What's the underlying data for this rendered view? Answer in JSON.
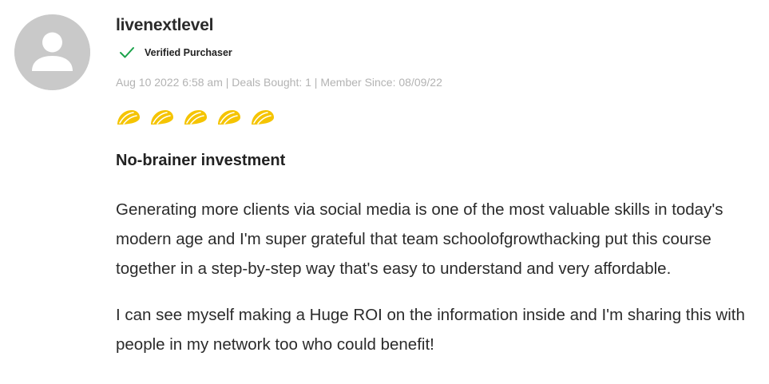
{
  "reviewer": {
    "username": "livenextlevel",
    "verified_label": "Verified Purchaser",
    "avatar_icon": "user-avatar-placeholder-icon",
    "check_icon": "checkmark-icon",
    "check_color": "#1aa24a"
  },
  "meta": {
    "text": "Aug 10 2022 6:58 am | Deals Bought: 1 | Member Since: 08/09/22"
  },
  "rating": {
    "value": 5,
    "max": 5,
    "icon": "taco-icon",
    "color": "#f5c400"
  },
  "review": {
    "title": "No-brainer investment",
    "paragraphs": [
      "Generating more clients via social media is one of the most valuable skills in today's modern age and I'm super grateful that team schoolofgrowthacking put this course together in a step-by-step way that's easy to understand and very affordable.",
      "I can see myself making a Huge ROI on the information inside and I'm sharing this with people in my network too who could benefit!"
    ]
  }
}
